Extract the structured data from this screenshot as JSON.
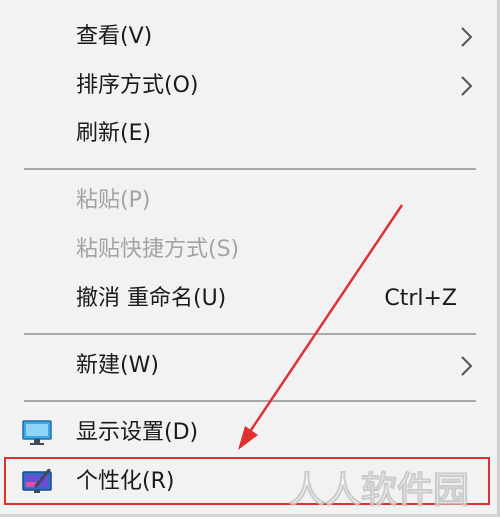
{
  "menu": {
    "items": [
      {
        "label": "查看(V)",
        "shortcut": "",
        "submenu": true,
        "disabled": false
      },
      {
        "label": "排序方式(O)",
        "shortcut": "",
        "submenu": true,
        "disabled": false
      },
      {
        "label": "刷新(E)",
        "shortcut": "",
        "submenu": false,
        "disabled": false
      },
      {
        "label": "粘贴(P)",
        "shortcut": "",
        "submenu": false,
        "disabled": true
      },
      {
        "label": "粘贴快捷方式(S)",
        "shortcut": "",
        "submenu": false,
        "disabled": true
      },
      {
        "label": "撤消 重命名(U)",
        "shortcut": "Ctrl+Z",
        "submenu": false,
        "disabled": false
      },
      {
        "label": "新建(W)",
        "shortcut": "",
        "submenu": true,
        "disabled": false
      },
      {
        "label": "显示设置(D)",
        "shortcut": "",
        "submenu": false,
        "disabled": false,
        "icon": "display-settings-icon"
      },
      {
        "label": "个性化(R)",
        "shortcut": "",
        "submenu": false,
        "disabled": false,
        "icon": "personalize-icon"
      }
    ]
  },
  "annotation": {
    "highlight_color": "#e0302f",
    "highlighted_item": "个性化(R)"
  },
  "watermark": {
    "text": "人人软件园"
  },
  "colors": {
    "menu_background": "#f2f2f2",
    "text": "#1a1a1a",
    "disabled_text": "#a3a3a3",
    "separator": "#a8a8a8"
  }
}
